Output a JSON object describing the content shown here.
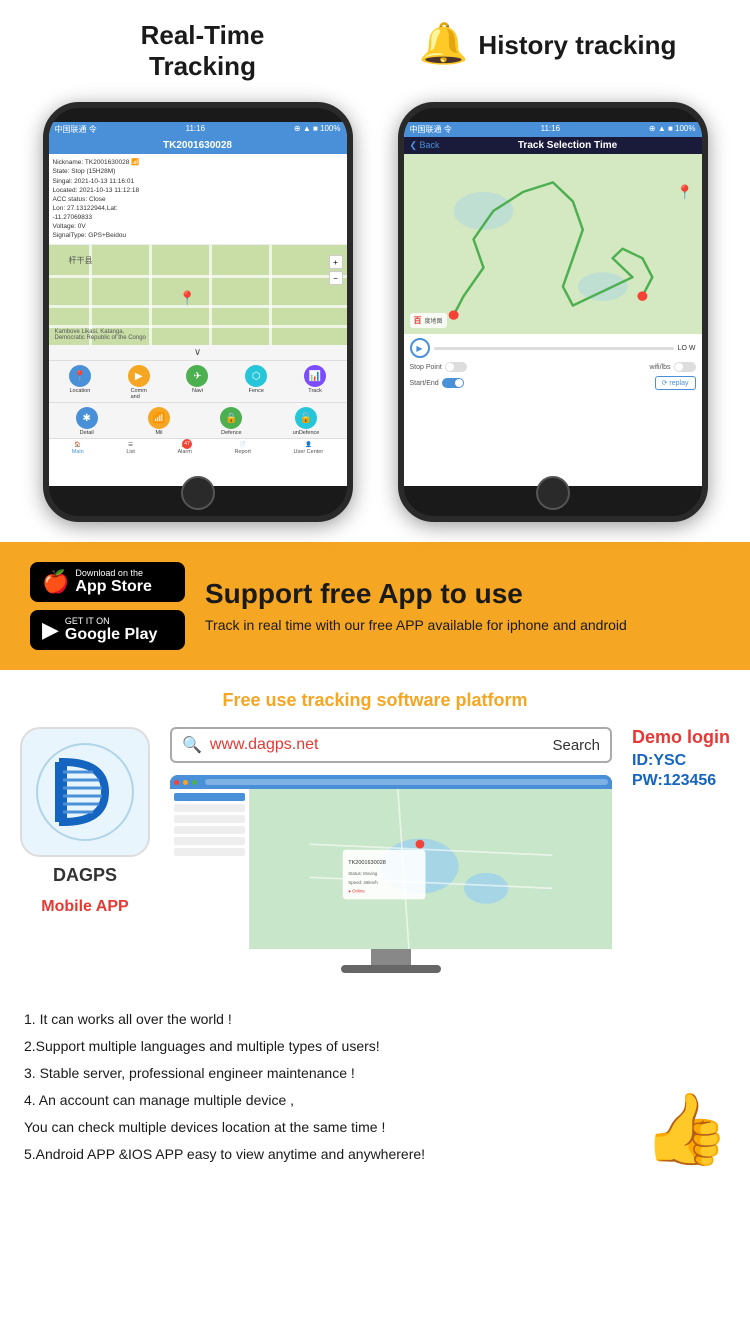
{
  "header": {
    "left_title_line1": "Real-Time",
    "left_title_line2": "Tracking",
    "right_title": "History tracking",
    "bell_icon": "🔔"
  },
  "phone_left": {
    "status_bar": "中国联通 令  11:16  ● ▲ ■ 100%",
    "device_id": "TK2001630028",
    "info_lines": [
      "Nickname: TK2001630028",
      "State: Stop (15H28M)",
      "Singal: 2021-10-13 11:16:01",
      "Located: 2021-10-13 11:12:18",
      "ACC status: Close",
      "Lon: 27.13122944,Lat:",
      "-11.27069833",
      "Voltage: 0V",
      "SignalType: GPS+Beidou"
    ],
    "location_label": "Kambove Likasi, Katanga, Democratic Republic of the Congo",
    "buttons": [
      {
        "label": "Location",
        "icon": "📍",
        "color": "btn-blue"
      },
      {
        "label": "Command",
        "icon": "▶",
        "color": "btn-orange"
      },
      {
        "label": "Navi",
        "icon": "✈",
        "color": "btn-green"
      },
      {
        "label": "Fence",
        "icon": "⬡",
        "color": "btn-teal"
      },
      {
        "label": "Track",
        "icon": "📊",
        "color": "btn-purple"
      }
    ],
    "buttons2": [
      {
        "label": "Detail",
        "icon": "✱",
        "color": "btn-blue"
      },
      {
        "label": "Mil",
        "icon": "📶",
        "color": "btn-orange"
      },
      {
        "label": "Defence",
        "icon": "🔒",
        "color": "btn-green"
      },
      {
        "label": "unDefence",
        "icon": "🔓",
        "color": "btn-teal"
      }
    ],
    "nav": [
      {
        "label": "Main",
        "active": true
      },
      {
        "label": "List"
      },
      {
        "label": "Alarm",
        "badge": "47"
      },
      {
        "label": "Report"
      },
      {
        "label": "User Center"
      }
    ]
  },
  "phone_right": {
    "status_bar": "中国联通 令  11:16  ● ▲ ■ 100%",
    "back_label": "Back",
    "header_title": "Track Selection Time",
    "playback": {
      "speed_label": "LO W",
      "stop_point_label": "Stop Point",
      "wifi_lbs_label": "wifi/lbs",
      "start_end_label": "Start/End",
      "replay_label": "⟳ replay"
    }
  },
  "banner": {
    "app_store_top": "Download on the",
    "app_store_bottom": "App Store",
    "google_play_top": "GET IT ON",
    "google_play_bottom": "Google Play",
    "title": "Support free App to use",
    "subtitle": "Track in real time with our free APP available for iphone and android"
  },
  "platform": {
    "section_title": "Free use tracking software platform",
    "search_url": "www.dagps.net",
    "search_button": "Search",
    "search_icon": "🔍",
    "app_name": "DAGPS",
    "mobile_app_label": "Mobile APP",
    "demo": {
      "title": "Demo login",
      "id_label": "ID:YSC",
      "pw_label": "PW:123456"
    }
  },
  "features": {
    "items": [
      "1. It can works all over the world !",
      "2.Support multiple languages and multiple types of users!",
      "3. Stable server, professional engineer maintenance !",
      "4. An account can manage multiple device ,",
      "You can check multiple devices location at the same time !",
      "5.Android APP &IOS APP easy to view anytime and anywherere!"
    ],
    "thumbs_icon": "👍"
  }
}
